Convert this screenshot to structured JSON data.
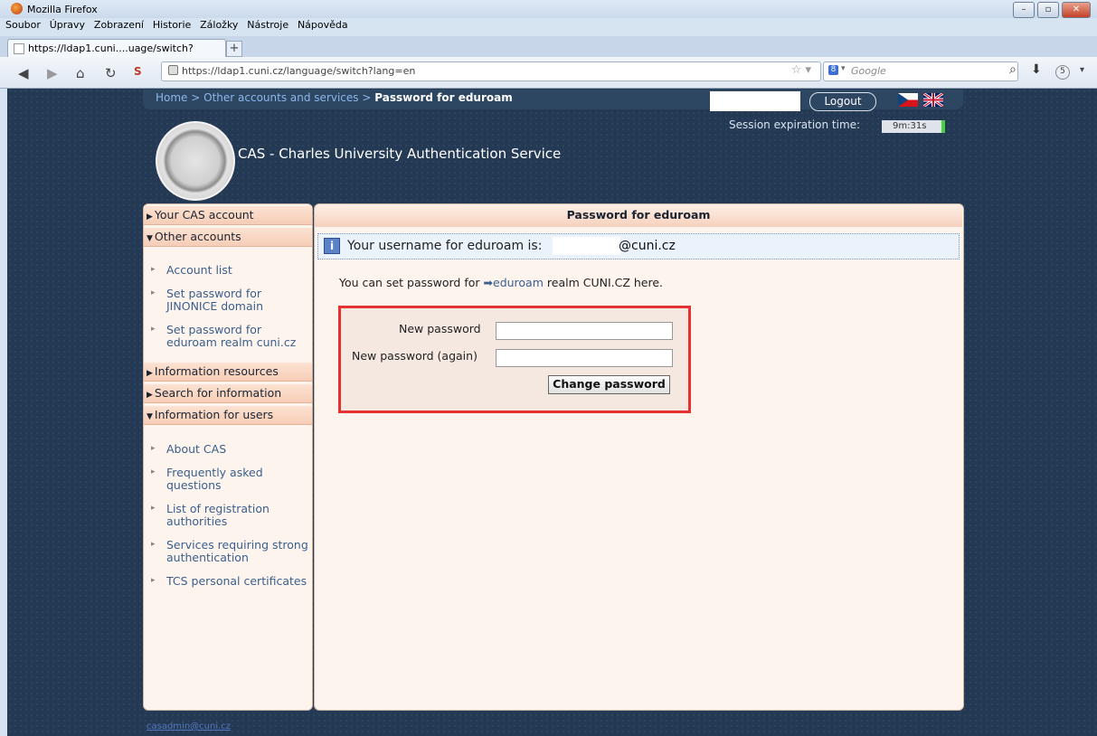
{
  "window": {
    "title": "Mozilla Firefox",
    "controls": [
      "–",
      "▫",
      "✕"
    ]
  },
  "menu": [
    "Soubor",
    "Úpravy",
    "Zobrazení",
    "Historie",
    "Záložky",
    "Nástroje",
    "Nápověda"
  ],
  "tab": {
    "label": "https://ldap1.cuni....uage/switch?lang=en",
    "new_tab": "+"
  },
  "nav": {
    "url": "https://ldap1.cuni.cz/language/switch?lang=en",
    "search_engine": "8",
    "search_placeholder": "Google",
    "downloads_count": "5",
    "icons": [
      "back-icon",
      "forward-icon",
      "home-icon",
      "reload-icon",
      "addon-icon",
      "lock-icon",
      "star-icon",
      "search-icon",
      "download-icon",
      "menu-arrow-icon"
    ]
  },
  "header": {
    "breadcrumb": {
      "home": "Home",
      "sep": ">",
      "other": "Other accounts and services",
      "current": "Password for eduroam"
    },
    "logout": "Logout",
    "session_label": "Session expiration time:",
    "session_time": "9m:31s",
    "service_title": "CAS - Charles University Authentication Service"
  },
  "sidebar": {
    "sections": [
      {
        "label": "Your CAS account",
        "state": "collapsed"
      },
      {
        "label": "Other accounts",
        "state": "expanded",
        "items": [
          "Account list",
          "Set password for JINONICE domain",
          "Set password for eduroam realm cuni.cz"
        ]
      },
      {
        "label": "Information resources",
        "state": "collapsed"
      },
      {
        "label": "Search for information",
        "state": "collapsed"
      },
      {
        "label": "Information for users",
        "state": "expanded",
        "items": [
          "About CAS",
          "Frequently asked questions",
          "List of registration authorities",
          "Services requiring strong authentication",
          "TCS personal certificates"
        ]
      }
    ],
    "footer_email": "casadmin@cuni.cz"
  },
  "main": {
    "heading": "Password for eduroam",
    "info_text": "Your username for eduroam is:",
    "info_domain": "@cuni.cz",
    "desc_before": "You can set password for",
    "desc_link": "eduroam",
    "desc_after": "realm CUNI.CZ here.",
    "form": {
      "new_password_label": "New password",
      "new_password_value": "",
      "new_password_again_label": "New password (again)",
      "new_password_again_value": "",
      "submit": "Change password"
    }
  },
  "colors": {
    "page_bg": "#243a54",
    "panel_bg": "#fdf4ed",
    "section_header": "#f5cdb7",
    "link": "#3a5f8e",
    "highlight_box": "#e53131"
  }
}
